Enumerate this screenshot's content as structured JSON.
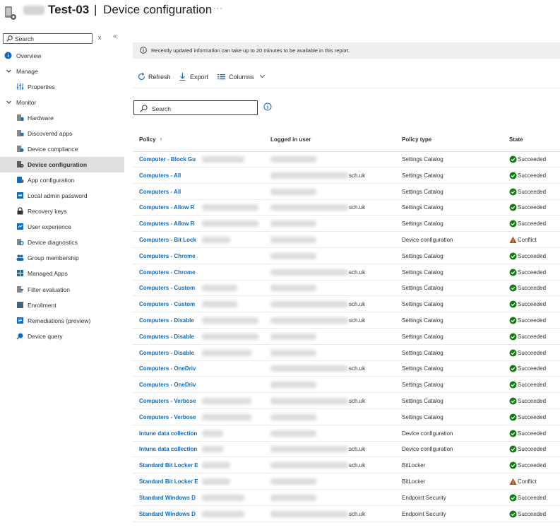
{
  "header": {
    "title_device": "Test-03",
    "title_separator": "|",
    "title_page": "Device configuration",
    "more": "···"
  },
  "sidebar": {
    "search_placeholder": "Search",
    "close_glyph": "x",
    "collapse_glyph": "«",
    "items": [
      {
        "label": "Overview",
        "icon": "info-icon",
        "kind": "item",
        "level": 0
      },
      {
        "label": "Manage",
        "icon": "chevron-down-icon",
        "kind": "group",
        "level": 0
      },
      {
        "label": "Properties",
        "icon": "properties-icon",
        "kind": "item",
        "level": 1
      },
      {
        "label": "Monitor",
        "icon": "chevron-down-icon",
        "kind": "group",
        "level": 0
      },
      {
        "label": "Hardware",
        "icon": "hardware-icon",
        "kind": "item",
        "level": 1
      },
      {
        "label": "Discovered apps",
        "icon": "apps-icon",
        "kind": "item",
        "level": 1
      },
      {
        "label": "Device compliance",
        "icon": "compliance-icon",
        "kind": "item",
        "level": 1
      },
      {
        "label": "Device configuration",
        "icon": "configuration-icon",
        "kind": "item",
        "level": 1,
        "active": true
      },
      {
        "label": "App configuration",
        "icon": "app-configuration-icon",
        "kind": "item",
        "level": 1
      },
      {
        "label": "Local admin password",
        "icon": "admin-password-icon",
        "kind": "item",
        "level": 1
      },
      {
        "label": "Recovery keys",
        "icon": "lock-icon",
        "kind": "item",
        "level": 1
      },
      {
        "label": "User experience",
        "icon": "user-experience-icon",
        "kind": "item",
        "level": 1
      },
      {
        "label": "Device diagnostics",
        "icon": "diagnostics-icon",
        "kind": "item",
        "level": 1
      },
      {
        "label": "Group membership",
        "icon": "group-icon",
        "kind": "item",
        "level": 1
      },
      {
        "label": "Managed Apps",
        "icon": "managed-apps-icon",
        "kind": "item",
        "level": 1
      },
      {
        "label": "Filter evaluation",
        "icon": "filter-icon",
        "kind": "item",
        "level": 1
      },
      {
        "label": "Enrollment",
        "icon": "enrollment-icon",
        "kind": "item",
        "level": 1
      },
      {
        "label": "Remediations (preview)",
        "icon": "remediations-icon",
        "kind": "item",
        "level": 1
      },
      {
        "label": "Device query",
        "icon": "device-query-icon",
        "kind": "item",
        "level": 1
      }
    ]
  },
  "banner": {
    "text": "Recently updated information can take up to 20 minutes to be available in this report."
  },
  "toolbar": {
    "refresh_label": "Refresh",
    "export_label": "Export",
    "columns_label": "Columns"
  },
  "search": {
    "placeholder": "Search"
  },
  "table": {
    "columns": [
      "Policy",
      "Logged in user",
      "Policy type",
      "State"
    ],
    "sort_glyph": "↑",
    "rows": [
      {
        "policy": "Computer - Block Gu",
        "user_suffix": "",
        "type": "Settings Catalog",
        "state": "Succeeded"
      },
      {
        "policy": "Computers - All",
        "user_suffix": "sch.uk",
        "type": "Settings Catalog",
        "state": "Succeeded"
      },
      {
        "policy": "Computers - All",
        "user_suffix": "",
        "type": "Settings Catalog",
        "state": "Succeeded"
      },
      {
        "policy": "Computers - Allow R",
        "user_suffix": "sch.uk",
        "type": "Settings Catalog",
        "state": "Succeeded"
      },
      {
        "policy": "Computers - Allow R",
        "user_suffix": "",
        "type": "Settings Catalog",
        "state": "Succeeded"
      },
      {
        "policy": "Computers - Bit Lock",
        "user_suffix": "",
        "type": "Device configuration",
        "state": "Conflict"
      },
      {
        "policy": "Computers - Chrome",
        "user_suffix": "",
        "type": "Settings Catalog",
        "state": "Succeeded"
      },
      {
        "policy": "Computers - Chrome",
        "user_suffix": "sch.uk",
        "type": "Settings Catalog",
        "state": "Succeeded"
      },
      {
        "policy": "Computers - Custom",
        "user_suffix": "",
        "type": "Settings Catalog",
        "state": "Succeeded"
      },
      {
        "policy": "Computers - Custom",
        "user_suffix": "sch.uk",
        "type": "Settings Catalog",
        "state": "Succeeded"
      },
      {
        "policy": "Computers - Disable",
        "user_suffix": "sch.uk",
        "type": "Settings Catalog",
        "state": "Succeeded"
      },
      {
        "policy": "Computers - Disable",
        "user_suffix": "",
        "type": "Settings Catalog",
        "state": "Succeeded"
      },
      {
        "policy": "Computers - Disable",
        "user_suffix": "",
        "type": "Settings Catalog",
        "state": "Succeeded"
      },
      {
        "policy": "Computers - OneDriv",
        "user_suffix": "sch.uk",
        "type": "Settings Catalog",
        "state": "Succeeded"
      },
      {
        "policy": "Computers - OneDriv",
        "user_suffix": "",
        "type": "Settings Catalog",
        "state": "Succeeded"
      },
      {
        "policy": "Computers - Verbose",
        "user_suffix": "sch.uk",
        "type": "Settings Catalog",
        "state": "Succeeded"
      },
      {
        "policy": "Computers - Verbose",
        "user_suffix": "",
        "type": "Settings Catalog",
        "state": "Succeeded"
      },
      {
        "policy": "Intune data collection",
        "user_suffix": "",
        "type": "Device configuration",
        "state": "Succeeded"
      },
      {
        "policy": "Intune data collection",
        "user_suffix": "sch.uk",
        "type": "Device configuration",
        "state": "Succeeded"
      },
      {
        "policy": "Standard Bit Locker E",
        "user_suffix": "sch.uk",
        "type": "BitLocker",
        "state": "Succeeded"
      },
      {
        "policy": "Standard Bit Locker E",
        "user_suffix": "",
        "type": "BitLocker",
        "state": "Conflict"
      },
      {
        "policy": "Standard Windows D",
        "user_suffix": "",
        "type": "Endpoint Security",
        "state": "Succeeded"
      },
      {
        "policy": "Standard Windows D",
        "user_suffix": "sch.uk",
        "type": "Endpoint Security",
        "state": "Succeeded"
      }
    ]
  },
  "colors": {
    "link": "#0f6cbd",
    "success": "#107c10",
    "warning": "#d83b01",
    "active_nav": "#e1dfdd",
    "banner": "#efefef"
  }
}
